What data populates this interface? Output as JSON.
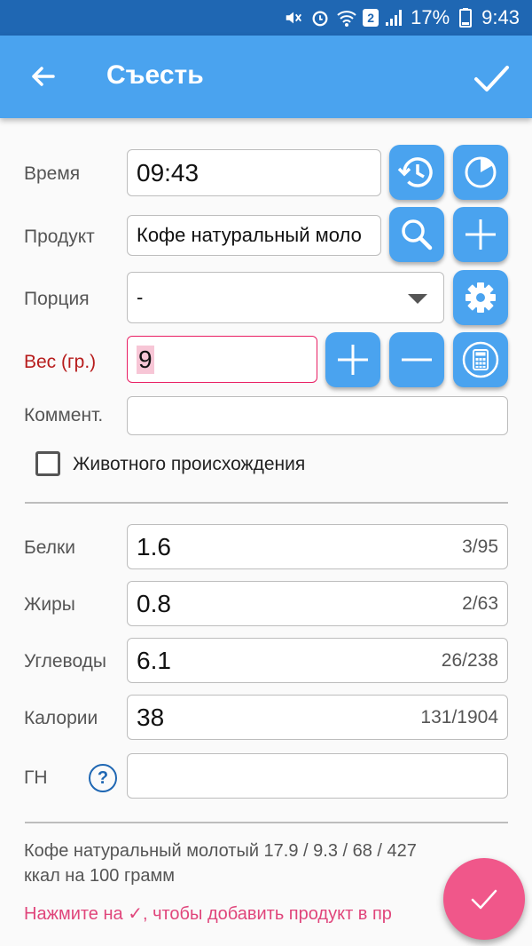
{
  "status_bar": {
    "battery_percent": "17%",
    "time": "9:43",
    "sim_badge": "2",
    "icons": [
      "mute-icon",
      "alarm-icon",
      "wifi-icon",
      "sim-icon",
      "signal-icon",
      "battery-icon"
    ]
  },
  "app_bar": {
    "title": "Съесть",
    "back_icon": "arrow-left-icon",
    "confirm_icon": "check-icon"
  },
  "form": {
    "time_label": "Время",
    "time_value": "09:43",
    "product_label": "Продукт",
    "product_value": "Кофе натуральный моло",
    "portion_label": "Порция",
    "portion_value": "-",
    "weight_label": "Вес (гр.)",
    "weight_value": "9",
    "comment_label": "Коммент.",
    "comment_value": "",
    "animal_origin_label": "Животного происхождения",
    "animal_origin_checked": false
  },
  "nutrition": {
    "protein_label": "Белки",
    "protein_value": "1.6",
    "protein_total": "3/95",
    "fat_label": "Жиры",
    "fat_value": "0.8",
    "fat_total": "2/63",
    "carbs_label": "Углеводы",
    "carbs_value": "6.1",
    "carbs_total": "26/238",
    "calories_label": "Калории",
    "calories_value": "38",
    "calories_total": "131/1904",
    "gl_label": "ГН",
    "gl_value": "",
    "help_symbol": "?"
  },
  "info": {
    "line1": "Кофе натуральный молотый  17.9 / 9.3 / 68 / 427",
    "line2": "ккал на 100 грамм",
    "hint": "Нажмите на ✓, чтобы добавить продукт в пр"
  },
  "colors": {
    "status_bar": "#1f67b3",
    "app_bar": "#4aa3ef",
    "button": "#4aa3ef",
    "fab": "#f0578a",
    "error": "#b71c1c",
    "hint": "#e0457b"
  }
}
